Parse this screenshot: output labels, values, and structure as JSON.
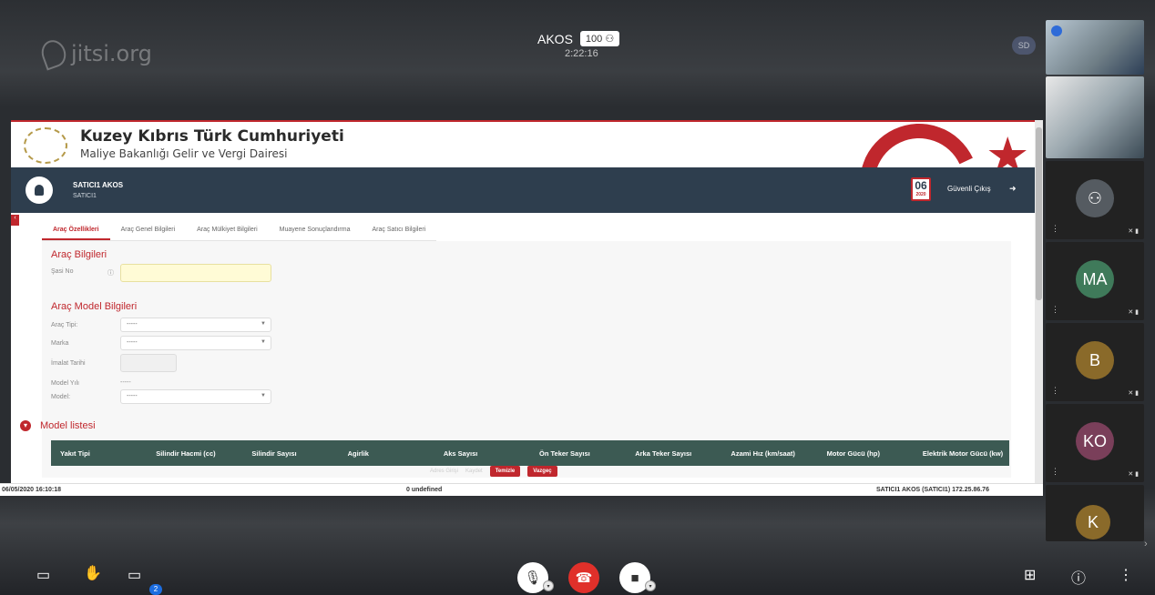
{
  "jitsi": {
    "logo_text": "jitsi.org"
  },
  "conference": {
    "title": "AKOS",
    "participants_badge": "100",
    "timer": "2:22:16",
    "self_initials": "SD"
  },
  "shared_screen": {
    "banner": {
      "title": "Kuzey Kıbrıs Türk Cumhuriyeti",
      "subtitle": "Maliye Bakanlığı Gelir ve Vergi Dairesi"
    },
    "userbar": {
      "name": "SATICI1 AKOS",
      "role": "SATICI1",
      "calendar_day": "06",
      "calendar_year": "2020",
      "logout_label": "Güvenli Çıkış"
    },
    "tabs": [
      "Araç Özellikleri",
      "Araç Genel Bilgileri",
      "Araç Mülkiyet Bilgileri",
      "Muayene Sonuçlandırma",
      "Araç Satıcı Bilgileri"
    ],
    "section_vehicle": "Araç Bilgileri",
    "field_chassis": "Şasi No",
    "section_model": "Araç Model Bilgileri",
    "fields": {
      "type_label": "Araç Tipi:",
      "type_value": "-----",
      "brand_label": "Marka",
      "brand_value": "-----",
      "mfg_label": "İmalat Tarihi",
      "year_label": "Model Yılı",
      "year_value": "-----",
      "model_label": "Model:",
      "model_value": "-----"
    },
    "model_list_title": "Model listesi",
    "table_headers": [
      "Yakıt Tipi",
      "Silindir Hacmi (cc)",
      "Silindir Sayısı",
      "Agirlik",
      "Aks Sayısı",
      "Ön Teker Sayısı",
      "Arka Teker Sayısı",
      "Azami Hız (km/saat)",
      "Motor Gücü (hp)",
      "Elektrik Motor Gücü (kw)"
    ],
    "actions": {
      "address": "Adres Girişi",
      "save": "Kaydet",
      "clear": "Temizle",
      "cancel": "Vazgeç"
    },
    "status": {
      "datetime": "06/05/2020 16:10:18",
      "center": "0 undefined",
      "user_ip": "SATICI1 AKOS (SATICI1) 172.25.86.76"
    }
  },
  "participants": [
    {
      "initials": "",
      "color": ""
    },
    {
      "initials": "",
      "color": ""
    },
    {
      "initials": "",
      "color": "#555b61"
    },
    {
      "initials": "MA",
      "color": "#3f7a5a"
    },
    {
      "initials": "B",
      "color": "#8a6a2a"
    },
    {
      "initials": "KO",
      "color": "#7a3f5a"
    },
    {
      "initials": "K",
      "color": "#8a6a2a"
    }
  ],
  "toolbar": {
    "chat_unread": "2"
  }
}
